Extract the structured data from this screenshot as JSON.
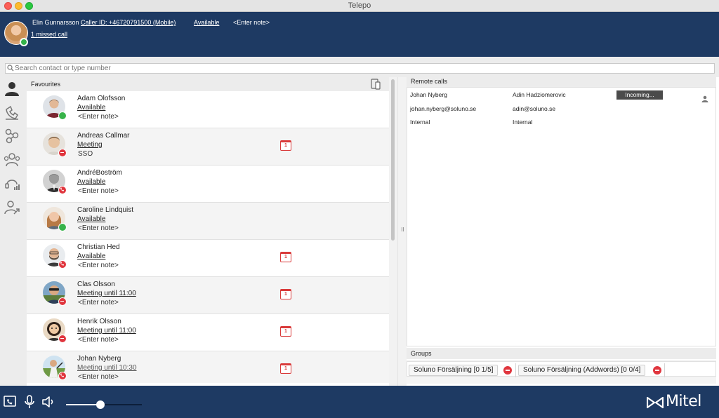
{
  "window": {
    "title": "Telepo"
  },
  "header": {
    "user_name": "Elin Gunnarsson",
    "caller_id": "Caller ID: +46720791500 (Mobile)",
    "status": "Available",
    "note": "<Enter note>",
    "missed_calls": "1 missed call"
  },
  "search": {
    "placeholder": "Search contact or type number"
  },
  "favourites": {
    "title": "Favourites",
    "contacts": [
      {
        "name": "Adam Olofsson",
        "status": "Available",
        "note": "<Enter note>",
        "presence": "available",
        "calendar": false
      },
      {
        "name": "Andreas Callmar",
        "status": "Meeting",
        "note": "SSO",
        "presence": "busy",
        "calendar": true
      },
      {
        "name": "AndréBoström",
        "status": "Available",
        "note": "<Enter note>",
        "presence": "on-call",
        "calendar": false
      },
      {
        "name": "Caroline Lindquist",
        "status": "Available",
        "note": "<Enter note>",
        "presence": "available",
        "calendar": false
      },
      {
        "name": "Christian Hed",
        "status": "Available",
        "note": "<Enter note>",
        "presence": "on-call",
        "calendar": true
      },
      {
        "name": "Clas Olsson",
        "status": "Meeting until 11:00",
        "note": "<Enter note>",
        "presence": "busy",
        "calendar": true
      },
      {
        "name": "Henrik Olsson",
        "status": "Meeting until 11:00",
        "note": "<Enter note>",
        "presence": "busy",
        "calendar": true
      },
      {
        "name": "Johan Nyberg",
        "status": "Meeting until 10:30",
        "note": "<Enter note>",
        "presence": "on-call",
        "calendar": true
      }
    ],
    "calendar_day": "1"
  },
  "remote_calls": {
    "title": "Remote calls",
    "caller": {
      "name": "Johan Nyberg",
      "email": "johan.nyberg@soluno.se",
      "type": "Internal"
    },
    "callee": {
      "name": "Adin Hadziomerovic",
      "email": "adin@soluno.se",
      "type": "Internal"
    },
    "state": "Incoming..."
  },
  "groups": {
    "title": "Groups",
    "items": [
      {
        "label": "Soluno Försäljning [0 1/5]"
      },
      {
        "label": "Soluno Försäljning (Addwords) [0 0/4]"
      }
    ]
  },
  "footer": {
    "brand": "Mitel",
    "volume_level": 0.45
  },
  "colors": {
    "header_bg": "#1e3a63",
    "available": "#37b34a",
    "busy": "#e0363e",
    "calendar": "#d93a3a"
  }
}
